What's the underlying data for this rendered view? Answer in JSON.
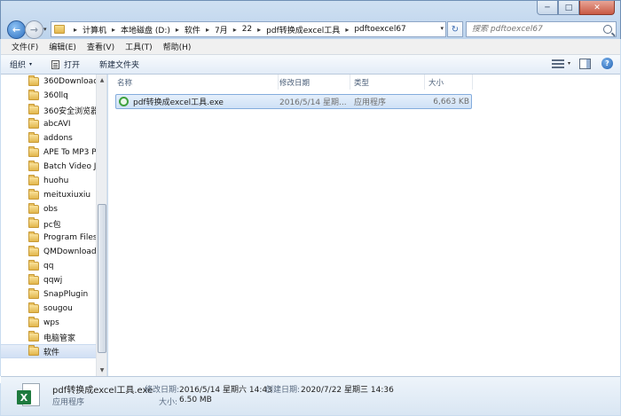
{
  "window": {
    "min_glyph": "─",
    "max_glyph": "□",
    "close_glyph": "✕"
  },
  "nav": {
    "back_glyph": "←",
    "forward_glyph": "→",
    "history_glyph": "▾"
  },
  "address": {
    "crumbs": [
      "计算机",
      "本地磁盘 (D:)",
      "软件",
      "7月",
      "22",
      "pdf转换成excel工具",
      "pdftoexcel67"
    ],
    "separator": "▸",
    "dropdown_glyph": "▾",
    "refresh_glyph": "↻"
  },
  "search": {
    "placeholder": "搜索 pdftoexcel67"
  },
  "menu": [
    "文件(F)",
    "编辑(E)",
    "查看(V)",
    "工具(T)",
    "帮助(H)"
  ],
  "commands": {
    "organize": "组织",
    "organize_arrow": "▾",
    "open": "打开",
    "new_folder": "新建文件夹",
    "view_arrow": "▾",
    "help_glyph": "?"
  },
  "tree": {
    "items": [
      "360Downloads",
      "360llq",
      "360安全浏览器",
      "abcAVI",
      "addons",
      "APE To MP3 Pl",
      "Batch Video Jo",
      "huohu",
      "meituxiuxiu",
      "obs",
      "pc包",
      "Program Files",
      "QMDownload",
      "qq",
      "qqwj",
      "SnapPlugin",
      "sougou",
      "wps",
      "电脑管家",
      "软件"
    ],
    "selected_index": 19,
    "scroll_up": "▲",
    "scroll_down": "▼"
  },
  "columns": [
    "名称",
    "修改日期",
    "类型",
    "大小"
  ],
  "files": [
    {
      "name": "pdf转换成excel工具.exe",
      "modified": "2016/5/14 星期...",
      "type": "应用程序",
      "size": "6,663 KB"
    }
  ],
  "details": {
    "filename": "pdf转换成excel工具.exe",
    "modified_label": "修改日期:",
    "modified_value": "2016/5/14 星期六 14:43",
    "created_label": "创建日期:",
    "created_value": "2020/7/22 星期三 14:36",
    "type_value": "应用程序",
    "size_label": "大小:",
    "size_value": "6.50 MB",
    "icon_letter": "X"
  },
  "colors": {
    "accent": "#3a6bb2",
    "selection": "#cfe1f6",
    "excel_green": "#1e7a3e"
  }
}
